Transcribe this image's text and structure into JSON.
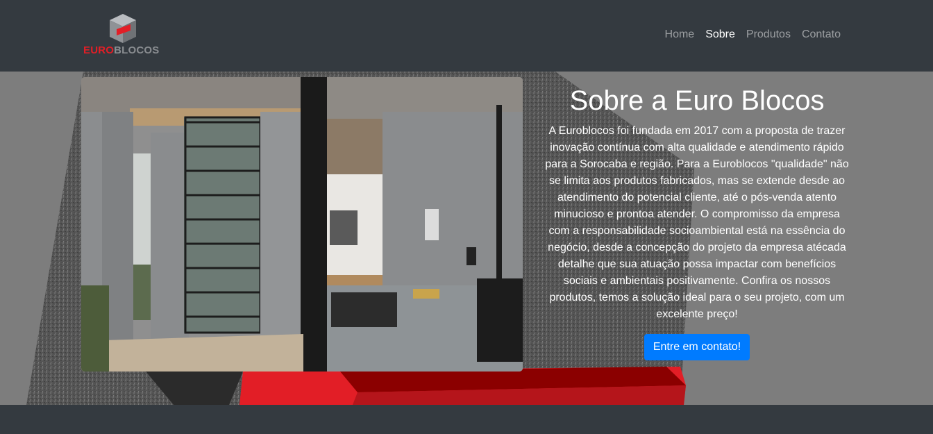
{
  "brand": {
    "part1": "EURO",
    "part2": "BLOCOS",
    "accent_color": "#e21e26",
    "gray_color": "#8a8d91"
  },
  "nav": {
    "items": [
      {
        "label": "Home",
        "active": false
      },
      {
        "label": "Sobre",
        "active": true
      },
      {
        "label": "Produtos",
        "active": false
      },
      {
        "label": "Contato",
        "active": false
      }
    ]
  },
  "about": {
    "title": "Sobre a Euro Blocos",
    "text": "A Euroblocos foi fundada em 2017 com a proposta de trazer inovação contínua com alta qualidade e atendimento rápido para a Sorocaba e região. Para a Euroblocos \"qualidade\" não se limita aos produtos fabricados, mas se extende desde ao atendimento do potencial cliente, até o pós-venda atento minucioso e prontoa atender. O compromisso da empresa com a responsabilidade socioambiental está na essência do negócio, desde a concepção do projeto da empresa atécada detalhe que sua atuação possa impactar com benefícios sociais e ambientais positivamente. Confira os nossos produtos, temos a solução ideal para o seu projeto, com um excelente preço!",
    "button_label": "Entre em contato!",
    "button_color": "#007bff"
  },
  "colors": {
    "navbar": "#343a40",
    "hero_bg": "#7d7d7d",
    "red_stripe": "#e21e26",
    "dark_red": "#8b0000"
  }
}
